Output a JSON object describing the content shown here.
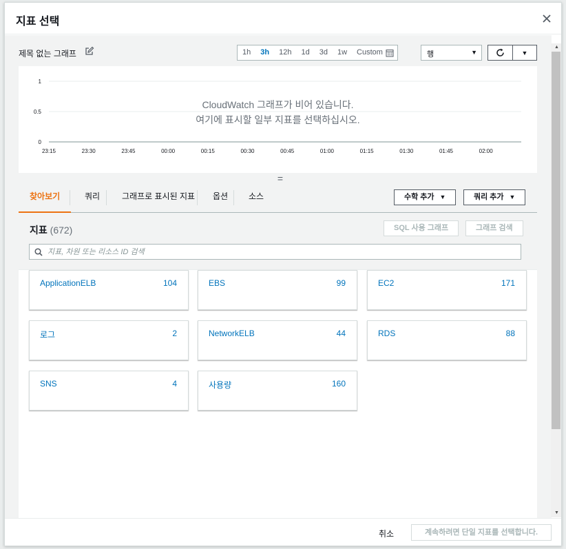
{
  "modal": {
    "title": "지표 선택"
  },
  "graph": {
    "title": "제목 없는 그래프",
    "time_options": [
      "1h",
      "3h",
      "12h",
      "1d",
      "3d",
      "1w"
    ],
    "active_time": "3h",
    "custom_label": "Custom",
    "chart_type_select": "행",
    "empty_line1": "CloudWatch 그래프가 비어 있습니다.",
    "empty_line2": "여기에 표시할 일부 지표를 선택하십시오.",
    "splitter": "="
  },
  "chart_data": {
    "type": "line",
    "series": [],
    "ylim": [
      0,
      1
    ],
    "yticks": [
      "0",
      "0.5",
      "1"
    ],
    "xticks": [
      "23:15",
      "23:30",
      "23:45",
      "00:00",
      "00:15",
      "00:30",
      "00:45",
      "01:00",
      "01:15",
      "01:30",
      "01:45",
      "02:00"
    ],
    "grid": true
  },
  "tabs": {
    "items": [
      "찾아보기",
      "쿼리",
      "그래프로 표시된 지표",
      "옵션",
      "소스"
    ],
    "active": "찾아보기",
    "math_button": "수학 추가",
    "query_button": "쿼리 추가"
  },
  "metrics": {
    "title": "지표",
    "count": "(672)",
    "sql_button": "SQL 사용 그래프",
    "search_graph_button": "그래프 검색",
    "search_placeholder": "지표, 차원 또는 리소스 ID 검색",
    "namespaces": [
      {
        "name": "ApplicationELB",
        "count": "104"
      },
      {
        "name": "EBS",
        "count": "99"
      },
      {
        "name": "EC2",
        "count": "171"
      },
      {
        "name": "로그",
        "count": "2"
      },
      {
        "name": "NetworkELB",
        "count": "44"
      },
      {
        "name": "RDS",
        "count": "88"
      },
      {
        "name": "SNS",
        "count": "4"
      },
      {
        "name": "사용량",
        "count": "160"
      }
    ]
  },
  "footer": {
    "cancel": "취소",
    "confirm": "계속하려면 단일 지표를 선택합니다."
  },
  "colors": {
    "accent": "#ec7211",
    "link": "#0073bb"
  }
}
